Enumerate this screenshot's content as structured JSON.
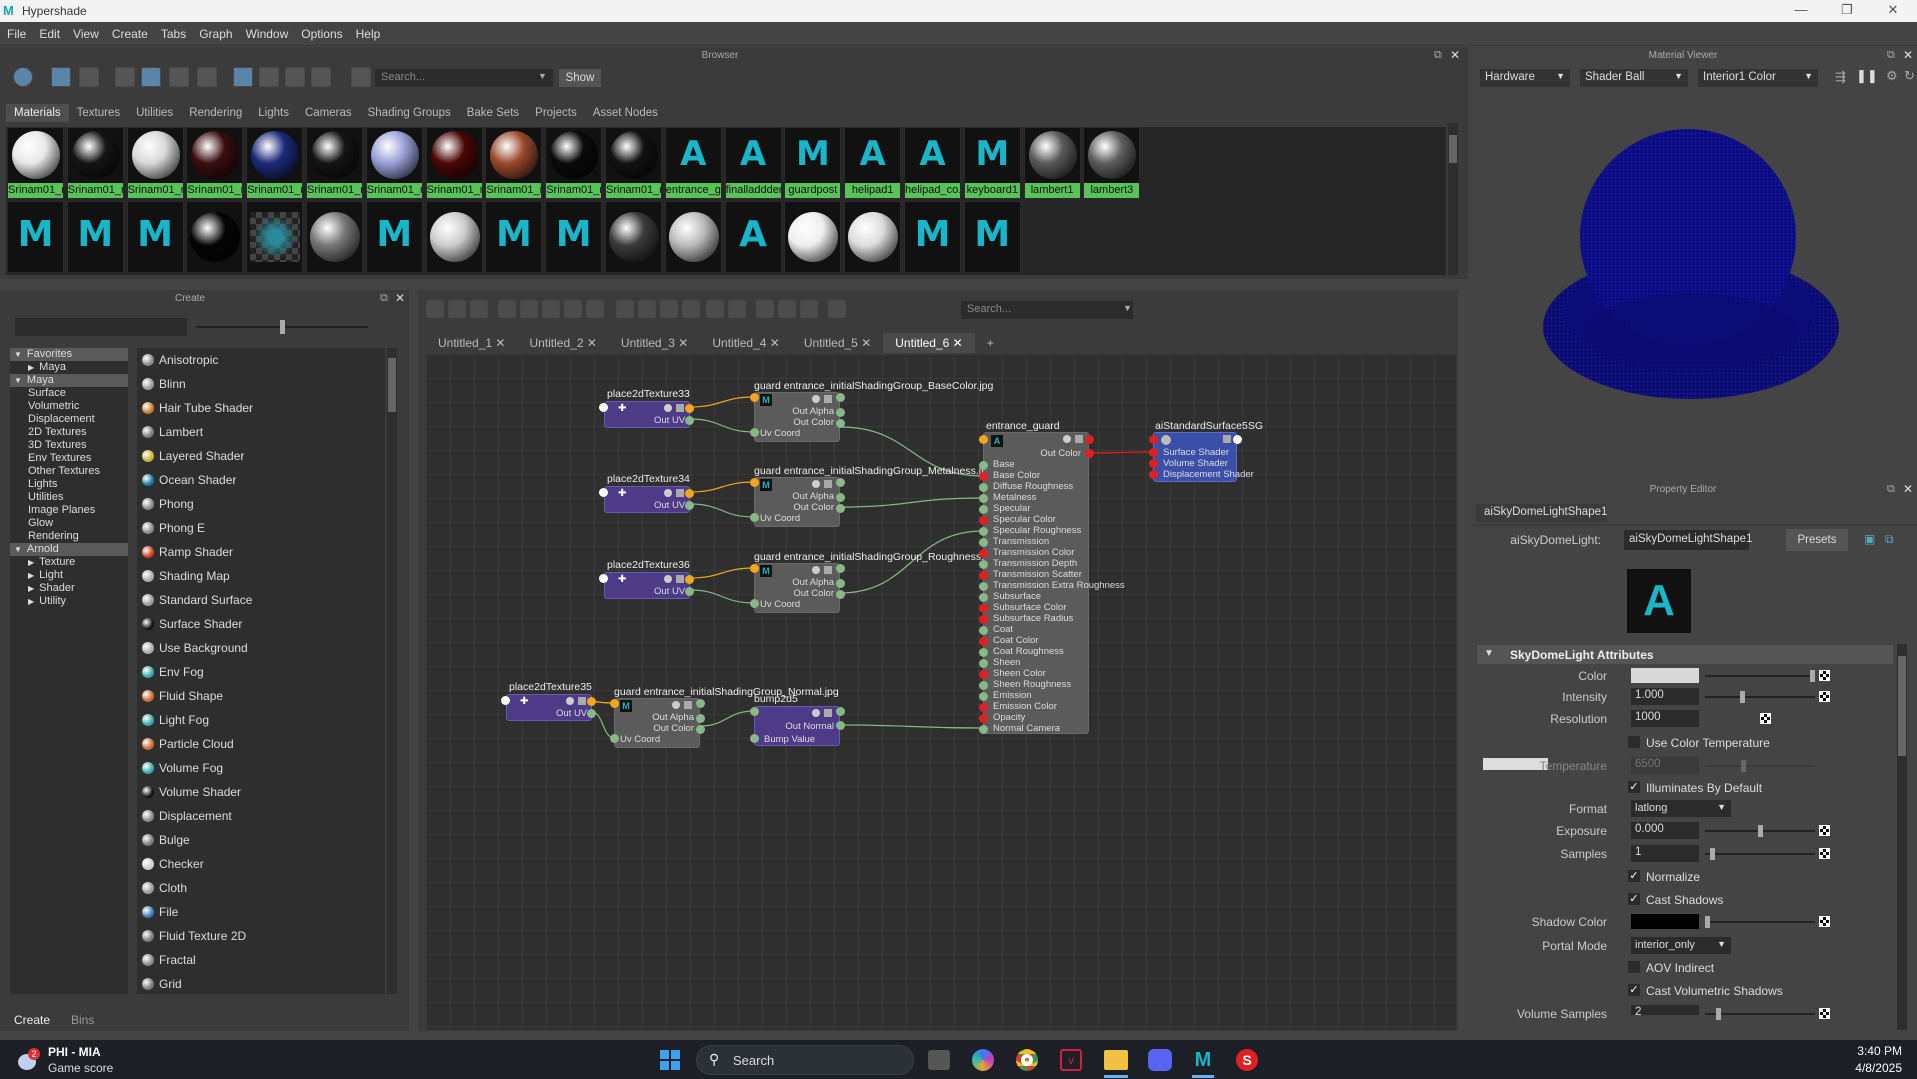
{
  "window": {
    "title": "Hypershade",
    "controls": [
      "minimize-icon",
      "restore-icon",
      "close-icon"
    ]
  },
  "menu": [
    "File",
    "Edit",
    "View",
    "Create",
    "Tabs",
    "Graph",
    "Window",
    "Options",
    "Help"
  ],
  "browser": {
    "title": "Browser",
    "search_placeholder": "Search...",
    "show_label": "Show",
    "tabs": [
      "Materials",
      "Textures",
      "Utilities",
      "Rendering",
      "Lights",
      "Cameras",
      "Shading Groups",
      "Bake Sets",
      "Projects",
      "Asset Nodes"
    ],
    "active_tab": "Materials",
    "row1": [
      {
        "label": "Srinam01_ri...",
        "kind": "ball",
        "color": "#e8e8e8"
      },
      {
        "label": "Srinam01_ri...",
        "kind": "ball",
        "color": "#151515"
      },
      {
        "label": "Srinam01_ri...",
        "kind": "ball",
        "color": "#d8d8d8"
      },
      {
        "label": "Srinam01_ri...",
        "kind": "ball",
        "color": "#3a0d10"
      },
      {
        "label": "Srinam01_ri...",
        "kind": "ball",
        "color": "#1c2a7a"
      },
      {
        "label": "Srinam01_ri...",
        "kind": "ball",
        "color": "#141414"
      },
      {
        "label": "Srinam01_ri...",
        "kind": "ball",
        "color": "#9aa0d8"
      },
      {
        "label": "Srinam01_ri...",
        "kind": "ball",
        "color": "#4a0606"
      },
      {
        "label": "Srinam01_ri...",
        "kind": "ball",
        "color": "#9a4a2c"
      },
      {
        "label": "Srinam01_ri...",
        "kind": "ball",
        "color": "#0a0a0a"
      },
      {
        "label": "Srinam01_ri...",
        "kind": "ball",
        "color": "#121212"
      },
      {
        "label": "entrance_g...",
        "kind": "A",
        "color": "#18b6c8"
      },
      {
        "label": "finalladdder",
        "kind": "A",
        "color": "#18b6c8"
      },
      {
        "label": "guardpost",
        "kind": "M",
        "color": "#18b6c8"
      },
      {
        "label": "helipad1",
        "kind": "A",
        "color": "#18b6c8"
      },
      {
        "label": "helipad_co...",
        "kind": "A",
        "color": "#18b6c8"
      },
      {
        "label": "keyboard1",
        "kind": "M",
        "color": "#18b6c8"
      },
      {
        "label": "lambert1",
        "kind": "ball",
        "color": "#5a5a5a"
      },
      {
        "label": "lambert3",
        "kind": "ball",
        "color": "#5e5e5e"
      }
    ],
    "row2": [
      {
        "kind": "M",
        "color": "#18b6c8"
      },
      {
        "kind": "M",
        "color": "#18b6c8"
      },
      {
        "kind": "M",
        "color": "#18b6c8"
      },
      {
        "kind": "ball",
        "color": "#050505"
      },
      {
        "kind": "checker",
        "color": "#2a8a9a"
      },
      {
        "kind": "ball",
        "color": "#777777"
      },
      {
        "kind": "M",
        "color": "#18b6c8"
      },
      {
        "kind": "ball",
        "color": "#cccccc"
      },
      {
        "kind": "M",
        "color": "#18b6c8"
      },
      {
        "kind": "M",
        "color": "#18b6c8"
      },
      {
        "kind": "ball",
        "color": "#3a3a3a"
      },
      {
        "kind": "ball",
        "color": "#bbbbbb"
      },
      {
        "kind": "A",
        "color": "#18b6c8"
      },
      {
        "kind": "ball",
        "color": "#eeeeee"
      },
      {
        "kind": "ball",
        "color": "#dddddd"
      },
      {
        "kind": "M",
        "color": "#18b6c8"
      },
      {
        "kind": "M",
        "color": "#18b6c8"
      }
    ]
  },
  "create": {
    "title": "Create",
    "tree": [
      {
        "label": "Favorites",
        "level": 0,
        "header": true,
        "open": true
      },
      {
        "label": "Maya",
        "level": 1,
        "header": false,
        "open": false
      },
      {
        "label": "Maya",
        "level": 0,
        "header": true,
        "open": true
      },
      {
        "label": "Surface",
        "level": 1
      },
      {
        "label": "Volumetric",
        "level": 1
      },
      {
        "label": "Displacement",
        "level": 1
      },
      {
        "label": "2D Textures",
        "level": 1
      },
      {
        "label": "3D Textures",
        "level": 1
      },
      {
        "label": "Env Textures",
        "level": 1
      },
      {
        "label": "Other Textures",
        "level": 1
      },
      {
        "label": "Lights",
        "level": 1
      },
      {
        "label": "Utilities",
        "level": 1
      },
      {
        "label": "Image Planes",
        "level": 1
      },
      {
        "label": "Glow",
        "level": 1
      },
      {
        "label": "Rendering",
        "level": 1
      },
      {
        "label": "Arnold",
        "level": 0,
        "header": true,
        "open": true
      },
      {
        "label": "Texture",
        "level": 1,
        "arrow": true
      },
      {
        "label": "Light",
        "level": 1,
        "arrow": true
      },
      {
        "label": "Shader",
        "level": 1,
        "arrow": true
      },
      {
        "label": "Utility",
        "level": 1,
        "arrow": true
      }
    ],
    "items": [
      {
        "label": "Anisotropic",
        "color": "#888"
      },
      {
        "label": "Blinn",
        "color": "#999"
      },
      {
        "label": "Hair Tube Shader",
        "color": "#c87a30"
      },
      {
        "label": "Lambert",
        "color": "#777"
      },
      {
        "label": "Layered Shader",
        "color": "#c8b030"
      },
      {
        "label": "Ocean Shader",
        "color": "#1a7a9a"
      },
      {
        "label": "Phong",
        "color": "#888"
      },
      {
        "label": "Phong E",
        "color": "#888"
      },
      {
        "label": "Ramp Shader",
        "color": "#d04020"
      },
      {
        "label": "Shading Map",
        "color": "#aaa"
      },
      {
        "label": "Standard Surface",
        "color": "#999"
      },
      {
        "label": "Surface Shader",
        "color": "#111"
      },
      {
        "label": "Use Background",
        "color": "#aaa"
      },
      {
        "label": "Env Fog",
        "color": "#3aa"
      },
      {
        "label": "Fluid Shape",
        "color": "#c86a30"
      },
      {
        "label": "Light Fog",
        "color": "#3aa"
      },
      {
        "label": "Particle Cloud",
        "color": "#c86a30"
      },
      {
        "label": "Volume Fog",
        "color": "#3aa"
      },
      {
        "label": "Volume Shader",
        "color": "#111"
      },
      {
        "label": "Displacement",
        "color": "#888"
      },
      {
        "label": "Bulge",
        "color": "#777"
      },
      {
        "label": "Checker",
        "color": "#ccc"
      },
      {
        "label": "Cloth",
        "color": "#999"
      },
      {
        "label": "File",
        "color": "#3a7ab8"
      },
      {
        "label": "Fluid Texture 2D",
        "color": "#777"
      },
      {
        "label": "Fractal",
        "color": "#888"
      },
      {
        "label": "Grid",
        "color": "#777"
      }
    ],
    "bottom_tabs": [
      "Create",
      "Bins"
    ]
  },
  "graph": {
    "search_placeholder": "Search...",
    "tabs": [
      "Untitled_1",
      "Untitled_2",
      "Untitled_3",
      "Untitled_4",
      "Untitled_5",
      "Untitled_6"
    ],
    "active_tab": "Untitled_6",
    "add_tab": "+",
    "place_nodes": [
      {
        "title": "place2dTexture33",
        "out": "Out UV"
      },
      {
        "title": "place2dTexture34",
        "out": "Out UV"
      },
      {
        "title": "place2dTexture36",
        "out": "Out UV"
      },
      {
        "title": "place2dTexture35",
        "out": "Out UV"
      }
    ],
    "file_nodes": [
      {
        "title": "guard entrance_initialShadingGroup_BaseColor.jpg",
        "rows": [
          "Out Alpha",
          "Out Color",
          "Uv Coord"
        ]
      },
      {
        "title": "guard entrance_initialShadingGroup_Metalness.jpg",
        "rows": [
          "Out Alpha",
          "Out Color",
          "Uv Coord"
        ]
      },
      {
        "title": "guard entrance_initialShadingGroup_Roughness.jpg",
        "rows": [
          "Out Alpha",
          "Out Color",
          "Uv Coord"
        ]
      },
      {
        "title": "guard entrance_initialShadingGroup_Normal.jpg",
        "rows": [
          "Out Alpha",
          "Out Color",
          "Uv Coord"
        ]
      }
    ],
    "bump_node": {
      "title": "bump2d5",
      "rows": [
        "Out Normal",
        "Bump Value"
      ]
    },
    "shader_node": {
      "title": "entrance_guard",
      "out": "Out Color",
      "attrs": [
        "Base",
        "Base Color",
        "Diffuse Roughness",
        "Metalness",
        "Specular",
        "Specular Color",
        "Specular Roughness",
        "Transmission",
        "Transmission Color",
        "Transmission Depth",
        "Transmission Scatter",
        "Transmission Extra Roughness",
        "Subsurface",
        "Subsurface Color",
        "Subsurface Radius",
        "Coat",
        "Coat Color",
        "Coat Roughness",
        "Sheen",
        "Sheen Color",
        "Sheen Roughness",
        "Emission",
        "Emission Color",
        "Opacity",
        "Normal Camera"
      ]
    },
    "sg_node": {
      "title": "aiStandardSurface5SG",
      "rows": [
        "Surface Shader",
        "Volume Shader",
        "Displacement Shader"
      ]
    }
  },
  "material_viewer": {
    "title": "Material Viewer",
    "renderer": "Hardware",
    "geometry": "Shader Ball",
    "env": "Interior1 Color"
  },
  "property_editor": {
    "title": "Property Editor",
    "node_tab": "aiSkyDomeLightShape1",
    "type_label": "aiSkyDomeLight:",
    "node_name": "aiSkyDomeLightShape1",
    "presets": "Presets",
    "section": "SkyDomeLight Attributes",
    "color_label": "Color",
    "intensity_label": "Intensity",
    "intensity": "1.000",
    "intensity_pos": 0.33,
    "resolution_label": "Resolution",
    "resolution": "1000",
    "use_color_temp": "Use Color Temperature",
    "temperature_label": "Temperature",
    "temperature": "6500",
    "illuminates": "Illuminates By Default",
    "format_label": "Format",
    "format": "latlong",
    "exposure_label": "Exposure",
    "exposure": "0.000",
    "exposure_pos": 0.5,
    "samples_label": "Samples",
    "samples": "1",
    "samples_pos": 0.05,
    "normalize": "Normalize",
    "cast_shadows": "Cast Shadows",
    "shadow_color_label": "Shadow Color",
    "portal_label": "Portal Mode",
    "portal": "interior_only",
    "aov_indirect": "AOV Indirect",
    "cast_volumetric": "Cast Volumetric Shadows",
    "volume_samples_label": "Volume Samples",
    "volume_samples": "2",
    "volume_samples_pos": 0.1
  },
  "taskbar": {
    "widget_title": "PHI - MIA",
    "widget_sub": "Game score",
    "badge": "2",
    "search": "Search",
    "time": "3:40 PM",
    "date": "4/8/2025"
  }
}
